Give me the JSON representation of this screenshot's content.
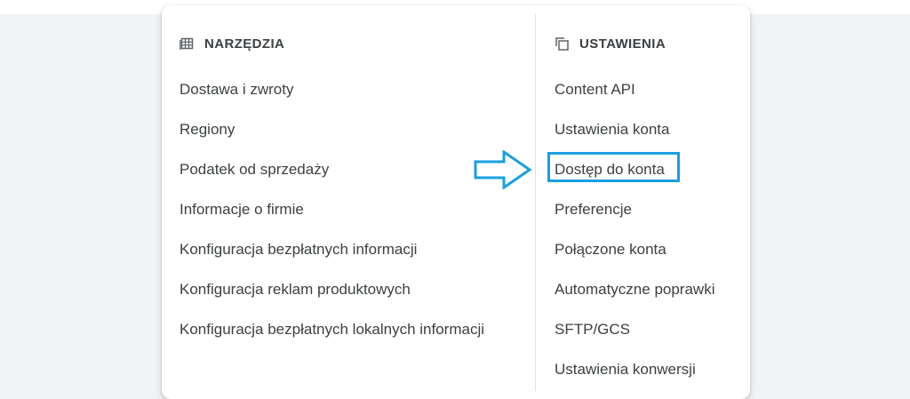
{
  "tools": {
    "header": "NARZĘDZIA",
    "icon": "table-grid-icon",
    "items": [
      "Dostawa i zwroty",
      "Regiony",
      "Podatek od sprzedaży",
      "Informacje o firmie",
      "Konfiguracja bezpłatnych informacji",
      "Konfiguracja reklam produktowych",
      "Konfiguracja bezpłatnych lokalnych informacji"
    ]
  },
  "settings": {
    "header": "USTAWIENIA",
    "icon": "copy-stack-icon",
    "items": [
      "Content API",
      "Ustawienia konta",
      "Dostęp do konta",
      "Preferencje",
      "Połączone konta",
      "Automatyczne poprawki",
      "SFTP/GCS",
      "Ustawienia konwersji"
    ]
  },
  "annotation": {
    "highlighted_item": "Dostęp do konta",
    "color": "#1a9fe0"
  }
}
